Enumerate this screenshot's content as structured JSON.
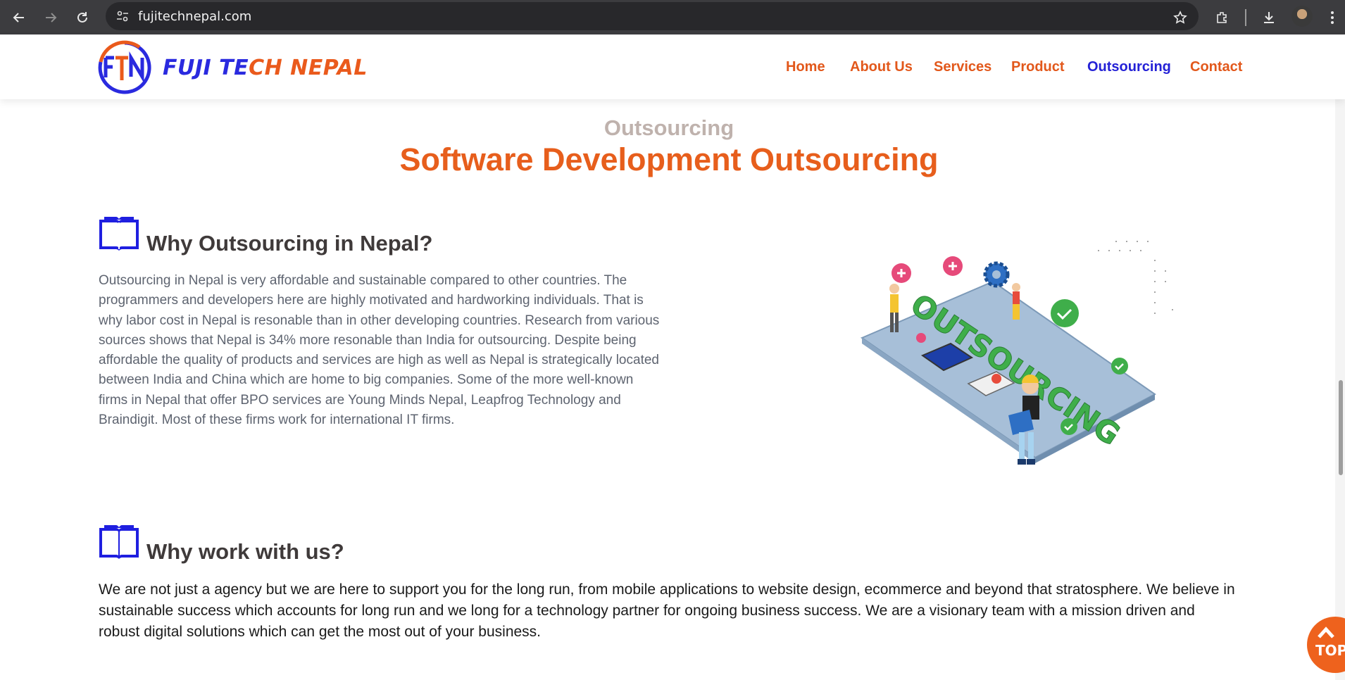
{
  "browser": {
    "url": "fujitechnepal.com",
    "icons": [
      "back-arrow-icon",
      "forward-arrow-icon",
      "reload-icon",
      "site-settings-icon",
      "star-icon",
      "extensions-icon",
      "download-icon",
      "menu-dots-icon"
    ]
  },
  "header": {
    "brand_part1": "FUJI TE",
    "brand_part2": "CH NEPAL",
    "logo_icon": "ftn-logo",
    "nav": [
      {
        "label": "Home",
        "active": false
      },
      {
        "label": "About Us",
        "active": false
      },
      {
        "label": "Services",
        "active": false
      },
      {
        "label": "Product",
        "active": false
      },
      {
        "label": "Outsourcing",
        "active": true
      },
      {
        "label": "Contact",
        "active": false
      }
    ],
    "colors": {
      "accent": "#e2581b",
      "active": "#2421d6"
    }
  },
  "page": {
    "kicker": "Outsourcing",
    "title": "Software Development Outsourcing"
  },
  "section1": {
    "icon": "book-icon",
    "title": "Why Outsourcing in Nepal?",
    "body": "Outsourcing in Nepal is very affordable and sustainable compared to other countries. The programmers and developers here are highly motivated and hardworking individuals. That is why labor cost in Nepal is resonable than in other developing countries. Research from various sources shows that Nepal is 34% more resonable than India for outsourcing. Despite being affordable the quality of products and services are high as well as Nepal is strategically located between India and China which are home to big companies. Some of the more well-known firms in Nepal that offer BPO services are Young Minds Nepal, Leapfrog Technology and Braindigit. Most of these firms work for international IT firms.",
    "illustration_text": "OUTSOURCING"
  },
  "section2": {
    "icon": "book-icon",
    "title": "Why work with us?",
    "body": "We are not just a agency but we are here to support you for the long run, from mobile applications to website design, ecommerce and beyond that stratosphere. We believe in sustainable success which accounts for long run and we long for a technology partner for ongoing business success. We are a visionary team with a mission driven and robust digital solutions which can get the most out of your business."
  },
  "scroll_top": {
    "label": "TOP"
  }
}
